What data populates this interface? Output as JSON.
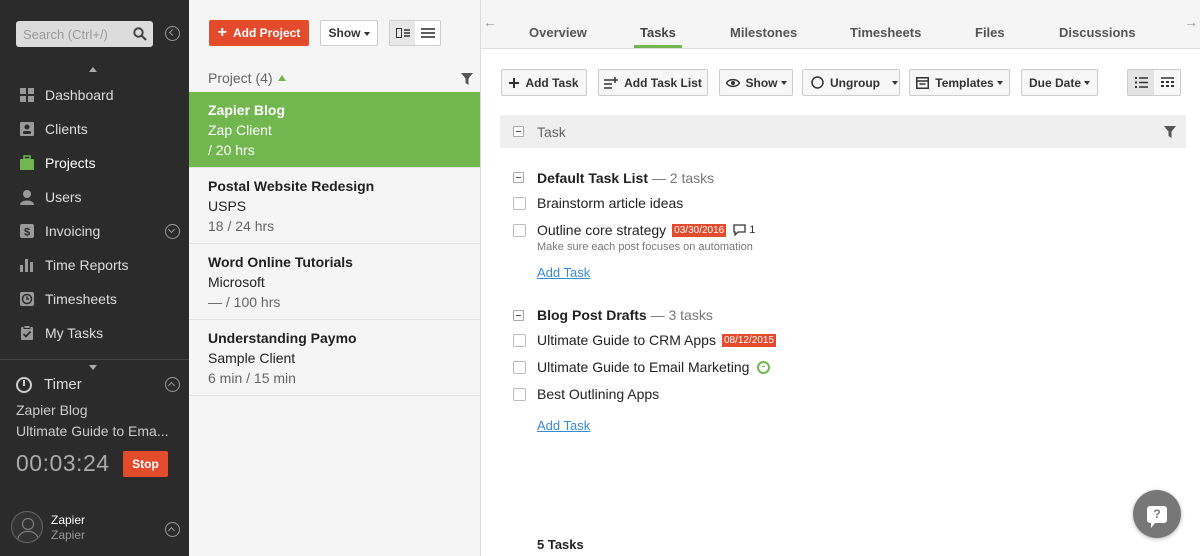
{
  "sidebar": {
    "search_placeholder": "Search (Ctrl+/)",
    "nav": [
      {
        "label": "Dashboard",
        "icon": "dashboard-icon"
      },
      {
        "label": "Clients",
        "icon": "clients-icon"
      },
      {
        "label": "Projects",
        "icon": "projects-icon",
        "active": true
      },
      {
        "label": "Users",
        "icon": "users-icon"
      },
      {
        "label": "Invoicing",
        "icon": "invoicing-icon"
      },
      {
        "label": "Time Reports",
        "icon": "time-reports-icon"
      },
      {
        "label": "Timesheets",
        "icon": "timesheets-icon"
      },
      {
        "label": "My Tasks",
        "icon": "my-tasks-icon"
      }
    ],
    "timer": {
      "label": "Timer",
      "project": "Zapier Blog",
      "task": "Ultimate Guide to Ema...",
      "elapsed": "00:03:24",
      "stop_label": "Stop"
    },
    "user": {
      "name": "Zapier",
      "org": "Zapier"
    }
  },
  "projects": {
    "add_label": "Add Project",
    "show_label": "Show",
    "header": "Project (4)",
    "items": [
      {
        "name": "Zapier Blog",
        "client": "Zap Client",
        "hours": "/ 20 hrs",
        "selected": true
      },
      {
        "name": "Postal Website Redesign",
        "client": "USPS",
        "hours": "18 / 24 hrs"
      },
      {
        "name": "Word Online Tutorials",
        "client": "Microsoft",
        "hours": "— / 100 hrs"
      },
      {
        "name": "Understanding Paymo",
        "client": "Sample Client",
        "hours": "6 min / 15 min"
      }
    ]
  },
  "tabs": [
    "Overview",
    "Tasks",
    "Milestones",
    "Timesheets",
    "Files",
    "Discussions"
  ],
  "active_tab": "Tasks",
  "toolbar": {
    "add_task": "Add Task",
    "add_task_list": "Add Task List",
    "show": "Show",
    "ungroup": "Ungroup",
    "templates": "Templates",
    "due_date": "Due Date"
  },
  "task_header": "Task",
  "lists": [
    {
      "title": "Default Task List",
      "count": "— 2 tasks",
      "tasks": [
        {
          "title": "Brainstorm article ideas"
        },
        {
          "title": "Outline core strategy",
          "due": "03/30/2016",
          "comments": "1",
          "description": "Make sure each post focuses on automation"
        }
      ],
      "add_label": "Add Task"
    },
    {
      "title": "Blog Post Drafts",
      "count": "— 3 tasks",
      "tasks": [
        {
          "title": "Ultimate Guide to CRM Apps",
          "due": "08/12/2015"
        },
        {
          "title": "Ultimate Guide to Email Marketing",
          "timer": true
        },
        {
          "title": "Best Outlining Apps"
        }
      ],
      "add_label": "Add Task"
    }
  ],
  "total": "5 Tasks",
  "help_label": "?",
  "colors": {
    "accent_green": "#71b64f",
    "brand_red": "#e44b2d",
    "link_blue": "#3a8ad0",
    "sidebar_bg": "#2b2b2b"
  }
}
